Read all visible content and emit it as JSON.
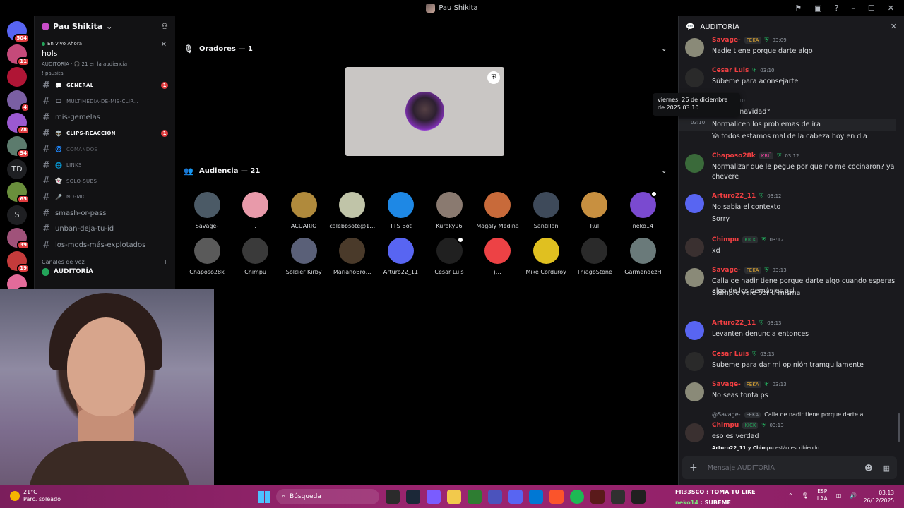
{
  "window": {
    "title": "Pau Shikita"
  },
  "servers": [
    {
      "name": "discord-home",
      "badge": "504",
      "color": "#5865f2"
    },
    {
      "name": "server-1",
      "badge": "11",
      "color": "#c54a7a"
    },
    {
      "name": "server-2",
      "badge": "",
      "color": "#b01535"
    },
    {
      "name": "server-3",
      "badge": "4",
      "color": "#7a5fa3"
    },
    {
      "name": "server-4",
      "badge": "78",
      "color": "#9b59d0"
    },
    {
      "name": "server-5",
      "badge": "94",
      "color": "#5c7b6d"
    },
    {
      "name": "server-td",
      "badge": "",
      "label": "TD"
    },
    {
      "name": "server-6",
      "badge": "65",
      "color": "#6a8f3c"
    },
    {
      "name": "server-s",
      "badge": "",
      "label": "S"
    },
    {
      "name": "server-7",
      "badge": "39",
      "color": "#a0527a"
    },
    {
      "name": "server-8",
      "badge": "19",
      "color": "#c43b3b"
    },
    {
      "name": "server-9",
      "badge": "14",
      "color": "#e36b9a"
    }
  ],
  "guild": {
    "name": "Pau Shikita"
  },
  "event": {
    "live_label": "En Vivo Ahora",
    "title": "hols",
    "meta": "AUDITORÍA · 🎧 21 en la audiencia",
    "meta2": "! pausita"
  },
  "channels": [
    {
      "name": "general",
      "icon": "💬",
      "style": "bold",
      "unread": "1"
    },
    {
      "name": "multimedia-de-mis-clip…",
      "icon": "🎞",
      "style": "normal",
      "unread": ""
    },
    {
      "name": "mis-gemelas",
      "icon": "",
      "style": "plain",
      "unread": ""
    },
    {
      "name": "clips-reacción",
      "icon": "👽",
      "style": "bold",
      "unread": "1"
    },
    {
      "name": "comandos",
      "icon": "🌀",
      "style": "muted",
      "unread": ""
    },
    {
      "name": "links",
      "icon": "🌐",
      "style": "normal",
      "unread": ""
    },
    {
      "name": "solo-subs",
      "icon": "👻",
      "style": "normal",
      "unread": ""
    },
    {
      "name": "no-mic",
      "icon": "🎤",
      "style": "normal",
      "unread": ""
    },
    {
      "name": "smash-or-pass",
      "icon": "",
      "style": "plain",
      "unread": ""
    },
    {
      "name": "unban-deja-tu-id",
      "icon": "",
      "style": "plain",
      "unread": ""
    },
    {
      "name": "los-mods-más-explotados",
      "icon": "",
      "style": "plain",
      "unread": ""
    }
  ],
  "voice_section": {
    "label": "Canales de voz",
    "channel": "AUDITORÍA"
  },
  "stage": {
    "speakers_label": "Oradores — 1",
    "audience_label": "Audiencia — 21",
    "audience": [
      {
        "name": "Savage-",
        "color": "#4b5a66"
      },
      {
        "name": ".",
        "color": "#e89aaa"
      },
      {
        "name": "ACUARIO",
        "color": "#b08a3c"
      },
      {
        "name": "calebbsote@1…",
        "color": "#c0c4a8"
      },
      {
        "name": "TTS Bot",
        "color": "#1e88e5"
      },
      {
        "name": "Kuroky96",
        "color": "#8a7a70"
      },
      {
        "name": "Magaly Medina",
        "color": "#c86a3a"
      },
      {
        "name": "Santillan",
        "color": "#3e4a5a"
      },
      {
        "name": "Rul",
        "color": "#c89040"
      },
      {
        "name": "neko14",
        "color": "#7a4ad0"
      },
      {
        "name": "Chaposo28k",
        "color": "#5a5a5a"
      },
      {
        "name": "Chimpu",
        "color": "#3a3a3a"
      },
      {
        "name": "Soldier Kirby",
        "color": "#5a6078"
      },
      {
        "name": "MarianoBro…",
        "color": "#4a3a2a"
      },
      {
        "name": "Arturo22_11",
        "color": "#5865f2"
      },
      {
        "name": "Cesar Luis",
        "color": "#202020"
      },
      {
        "name": "j…",
        "color": "#ed4245"
      },
      {
        "name": "Mike Corduroy",
        "color": "#e0c020"
      },
      {
        "name": "ThiagoStone",
        "color": "#2a2a2a"
      },
      {
        "name": "GarmendezH",
        "color": "#6a7a7a"
      }
    ]
  },
  "chat": {
    "header": "AUDITORÍA",
    "tooltip": "viernes, 26 de diciembre de 2025 03:10",
    "messages": [
      {
        "author": "Savage-",
        "tag": "FEKA",
        "time": "03:09",
        "lines": [
          "Nadie tiene porque darte algo"
        ],
        "color": "#f23f42",
        "avatar": "#8a8a78"
      },
      {
        "author": "Cesar Luis",
        "tag": "",
        "time": "03:10",
        "lines": [
          "Súbeme  para aconsejarte"
        ],
        "color": "#f23f42",
        "avatar": "#2a2a2a"
      },
      {
        "author": "…11",
        "tag": "",
        "time": "03:10",
        "lines": [
          "…on de navidad?"
        ],
        "color": "#f23f42",
        "avatar": ""
      },
      {
        "author": "",
        "tag": "",
        "time": "03:10",
        "lines": [
          "Normalicen los problemas de ira",
          "Ya todos estamos mal de la cabeza hoy en dia"
        ],
        "color": "",
        "avatar": ""
      },
      {
        "author": "Chaposo28k",
        "tag": "KRÜ",
        "time": "03:12",
        "lines": [
          "Normalizar que le pegue por que no me cocinaron? ya chevere"
        ],
        "color": "#f23f42",
        "avatar": "#3a6a3a"
      },
      {
        "author": "Arturo22_11",
        "tag": "",
        "time": "03:12",
        "lines": [
          "No sabia el contexto",
          "Sorry"
        ],
        "color": "#f23f42",
        "avatar": "#5865f2"
      },
      {
        "author": "Chimpu",
        "tag": "KICK",
        "time": "03:12",
        "lines": [
          "xd"
        ],
        "color": "#f23f42",
        "avatar": "#3a3030"
      },
      {
        "author": "Savage-",
        "tag": "FEKA",
        "time": "03:13",
        "lines": [
          "Calla oe nadir tiene porque darte algo cuando esperas algo de los demás es asi",
          "Siempre vale por ti misma"
        ],
        "color": "#f23f42",
        "avatar": "#8a8a78"
      },
      {
        "author": "Arturo22_11",
        "tag": "",
        "time": "03:13",
        "lines": [
          "Levanten denuncia entonces"
        ],
        "color": "#f23f42",
        "avatar": "#5865f2"
      },
      {
        "author": "Cesar Luis",
        "tag": "",
        "time": "03:13",
        "lines": [
          "Subeme para dar mi opinión  tramquilamente"
        ],
        "color": "#f23f42",
        "avatar": "#2a2a2a"
      },
      {
        "author": "Savage-",
        "tag": "FEKA",
        "time": "03:13",
        "lines": [
          "No seas tonta ps"
        ],
        "color": "#f23f42",
        "avatar": "#8a8a78"
      },
      {
        "author": "Chimpu",
        "tag": "KICK",
        "time": "03:13",
        "lines": [
          "eso es verdad"
        ],
        "color": "#f23f42",
        "avatar": "#3a3030"
      }
    ],
    "reply_ref": {
      "user": "@Savage-",
      "tag": "FEKA",
      "text": "Calla oe nadir tiene porque darte al…"
    },
    "typing": {
      "users": "Arturo22_11 y Chimpu",
      "suffix": "están escribiendo…"
    },
    "composer_placeholder": "Mensaje AUDITORÍA"
  },
  "taskbar": {
    "weather_temp": "21°C",
    "weather_desc": "Parc. soleado",
    "search_label": "Búsqueda",
    "marquee_line1": "FR33SCO : TOMA TU LIKE",
    "marquee_line2_user": "neko14",
    "marquee_line2_text": " : SUBEME",
    "lang_line1": "ESP",
    "lang_line2": "LAA",
    "time": "03:13",
    "date": "26/12/2025"
  }
}
